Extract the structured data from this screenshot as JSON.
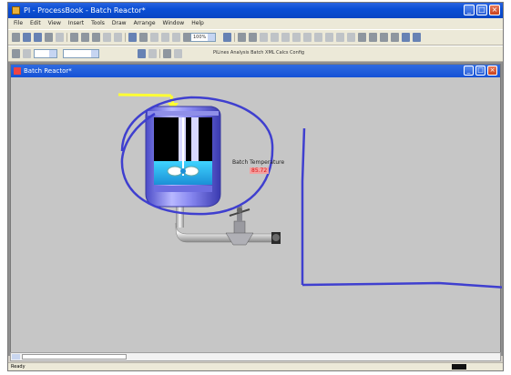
{
  "app": {
    "title": "PI - ProcessBook - Batch Reactor*"
  },
  "menu": [
    "File",
    "Edit",
    "View",
    "Insert",
    "Tools",
    "Draw",
    "Arrange",
    "Window",
    "Help"
  ],
  "toolbar": {
    "zoom": "100%",
    "text_controls": "PiLines Analysis Batch XML Calcs Config"
  },
  "child": {
    "title": "Batch Reactor*"
  },
  "display": {
    "temperature_label": "Batch Temperature",
    "temperature_value": "85.72",
    "accent_color": "#3f3fcf",
    "highlight_color": "#ffff33"
  },
  "status": {
    "text": "Ready"
  }
}
